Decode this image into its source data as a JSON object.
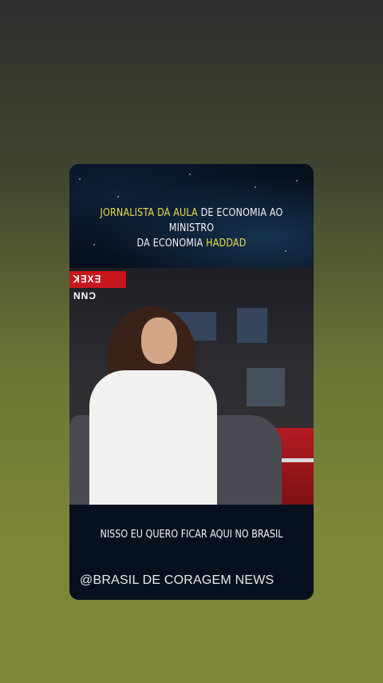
{
  "headline": {
    "highlight_1": "JORNALISTA DÁ AULA",
    "text_1": " DE ECONOMIA AO MINISTRO",
    "text_2": "DA ECONOMIA ",
    "highlight_2": "HADDAD"
  },
  "video": {
    "channel_logo": "ꓘ∃X∃ NNƆ"
  },
  "subtitle": "NISSO EU QUERO FICAR AQUI NO BRASIL",
  "watermark": "@BRASIL DE CORAGEM NEWS",
  "colors": {
    "highlight": "#e6de4a",
    "card_background": "#07101e",
    "cnn_red": "#c8161e"
  }
}
